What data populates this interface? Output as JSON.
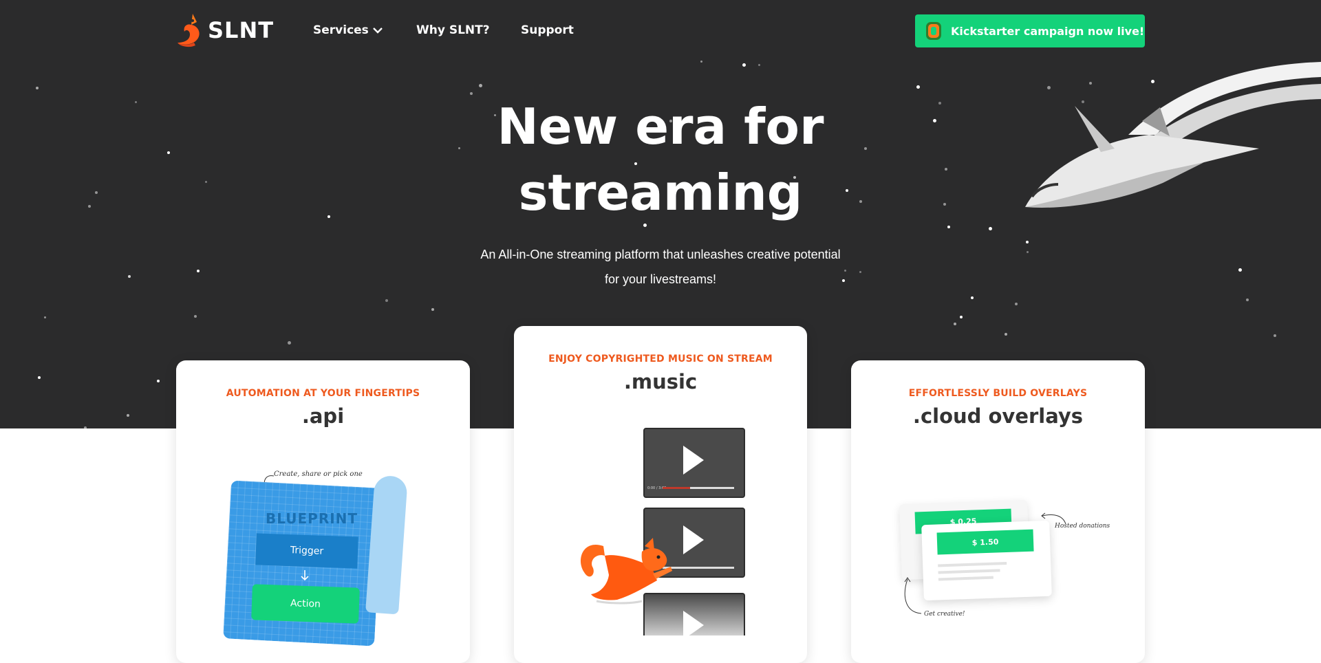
{
  "brand": {
    "name": "SLNT"
  },
  "nav": {
    "services": "Services",
    "why": "Why SLNT?",
    "support": "Support"
  },
  "cta": {
    "label": "Kickstarter campaign now live!"
  },
  "hero": {
    "title_line1": "New era for",
    "title_line2": "streaming",
    "subtitle_line1": "An All-in-One streaming platform that unleashes creative potential",
    "subtitle_line2": "for your livestreams!"
  },
  "cards": {
    "api": {
      "kicker": "AUTOMATION AT YOUR FINGERTIPS",
      "title": ".api",
      "blueprint_label": "BLUEPRINT",
      "trigger": "Trigger",
      "action": "Action",
      "note": "Create, share or pick one"
    },
    "music": {
      "kicker": "ENJOY COPYRIGHTED MUSIC ON STREAM",
      "title": ".music",
      "player_time": "0:00 / 3:00"
    },
    "overlays": {
      "kicker": "EFFORTLESSLY BUILD OVERLAYS",
      "title": ".cloud overlays",
      "donation_back": "$ 0.25",
      "donation_front": "$ 1.50",
      "note_hosted": "Hosted donations",
      "note_creative": "Get creative!"
    }
  },
  "colors": {
    "hero_bg": "#2b2b2c",
    "accent_green": "#14d27a",
    "accent_orange": "#ee5a1f",
    "blueprint_blue": "#3a9be6"
  }
}
